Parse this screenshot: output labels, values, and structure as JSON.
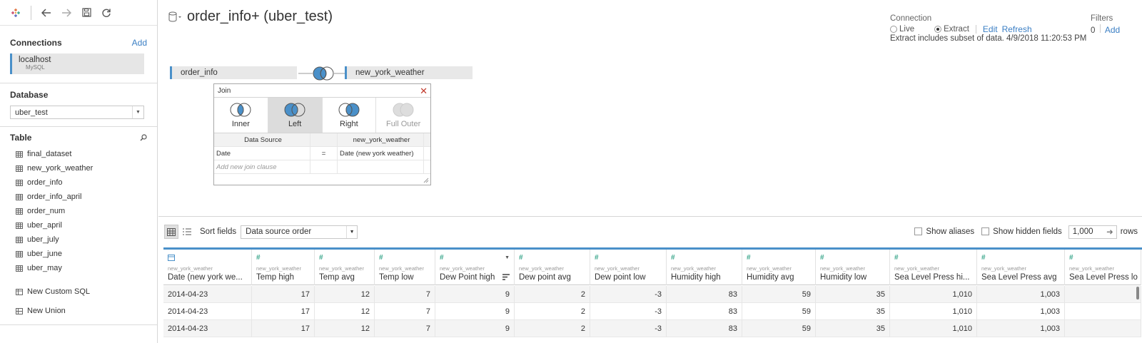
{
  "sidebar": {
    "connections": {
      "title": "Connections",
      "add_label": "Add",
      "items": [
        {
          "name": "localhost",
          "type": "MySQL"
        }
      ]
    },
    "database": {
      "title": "Database",
      "selected": "uber_test"
    },
    "table": {
      "title": "Table",
      "items": [
        "final_dataset",
        "new_york_weather",
        "order_info",
        "order_info_april",
        "order_num",
        "uber_april",
        "uber_july",
        "uber_june",
        "uber_may"
      ]
    },
    "actions": {
      "custom_sql": "New Custom SQL",
      "union": "New Union"
    }
  },
  "header": {
    "title": "order_info+ (uber_test)",
    "connection": {
      "label": "Connection",
      "live": "Live",
      "extract": "Extract",
      "selected": "extract",
      "edit": "Edit",
      "refresh": "Refresh",
      "note": "Extract includes subset of data. 4/9/2018 11:20:53 PM"
    },
    "filters": {
      "label": "Filters",
      "count": "0",
      "add": "Add"
    }
  },
  "join": {
    "left_table": "order_info",
    "right_table": "new_york_weather",
    "dialog": {
      "title": "Join",
      "types": [
        {
          "label": "Inner",
          "selected": false,
          "disabled": false
        },
        {
          "label": "Left",
          "selected": true,
          "disabled": false
        },
        {
          "label": "Right",
          "selected": false,
          "disabled": false
        },
        {
          "label": "Full Outer",
          "selected": false,
          "disabled": true
        }
      ],
      "header_left": "Data Source",
      "header_right": "new_york_weather",
      "clauses": [
        {
          "left": "Date",
          "op": "=",
          "right": "Date (new york weather)"
        }
      ],
      "add_clause_placeholder": "Add new join clause"
    }
  },
  "grid_toolbar": {
    "sort_label": "Sort fields",
    "sort_value": "Data source order",
    "show_aliases": "Show aliases",
    "show_hidden": "Show hidden fields",
    "rows_value": "1,000",
    "rows_label": "rows"
  },
  "grid": {
    "columns": [
      {
        "source": "new_york_weather",
        "name": "Date (new york we...",
        "type": "date"
      },
      {
        "source": "new_york_weather",
        "name": "Temp high",
        "type": "number"
      },
      {
        "source": "new_york_weather",
        "name": "Temp avg",
        "type": "number"
      },
      {
        "source": "new_york_weather",
        "name": "Temp low",
        "type": "number"
      },
      {
        "source": "new_york_weather",
        "name": "Dew Point high",
        "type": "number"
      },
      {
        "source": "new_york_weather",
        "name": "Dew point avg",
        "type": "number"
      },
      {
        "source": "new_york_weather",
        "name": "Dew point low",
        "type": "number"
      },
      {
        "source": "new_york_weather",
        "name": "Humidity high",
        "type": "number"
      },
      {
        "source": "new_york_weather",
        "name": "Humidity avg",
        "type": "number"
      },
      {
        "source": "new_york_weather",
        "name": "Humidity low",
        "type": "number"
      },
      {
        "source": "new_york_weather",
        "name": "Sea Level Press hi...",
        "type": "number"
      },
      {
        "source": "new_york_weather",
        "name": "Sea Level Press avg",
        "type": "number"
      },
      {
        "source": "new_york_weather",
        "name": "Sea Level Press lo",
        "type": "number"
      }
    ],
    "rows": [
      [
        "2014-04-23",
        "17",
        "12",
        "7",
        "9",
        "2",
        "-3",
        "83",
        "59",
        "35",
        "1,010",
        "1,003",
        ""
      ],
      [
        "2014-04-23",
        "17",
        "12",
        "7",
        "9",
        "2",
        "-3",
        "83",
        "59",
        "35",
        "1,010",
        "1,003",
        ""
      ],
      [
        "2014-04-23",
        "17",
        "12",
        "7",
        "9",
        "2",
        "-3",
        "83",
        "59",
        "35",
        "1,010",
        "1,003",
        ""
      ]
    ]
  },
  "colors": {
    "accent": "#4a90c9",
    "link": "#3b7fc4",
    "close": "#c0392b",
    "type_icon": "#3aa68b"
  }
}
